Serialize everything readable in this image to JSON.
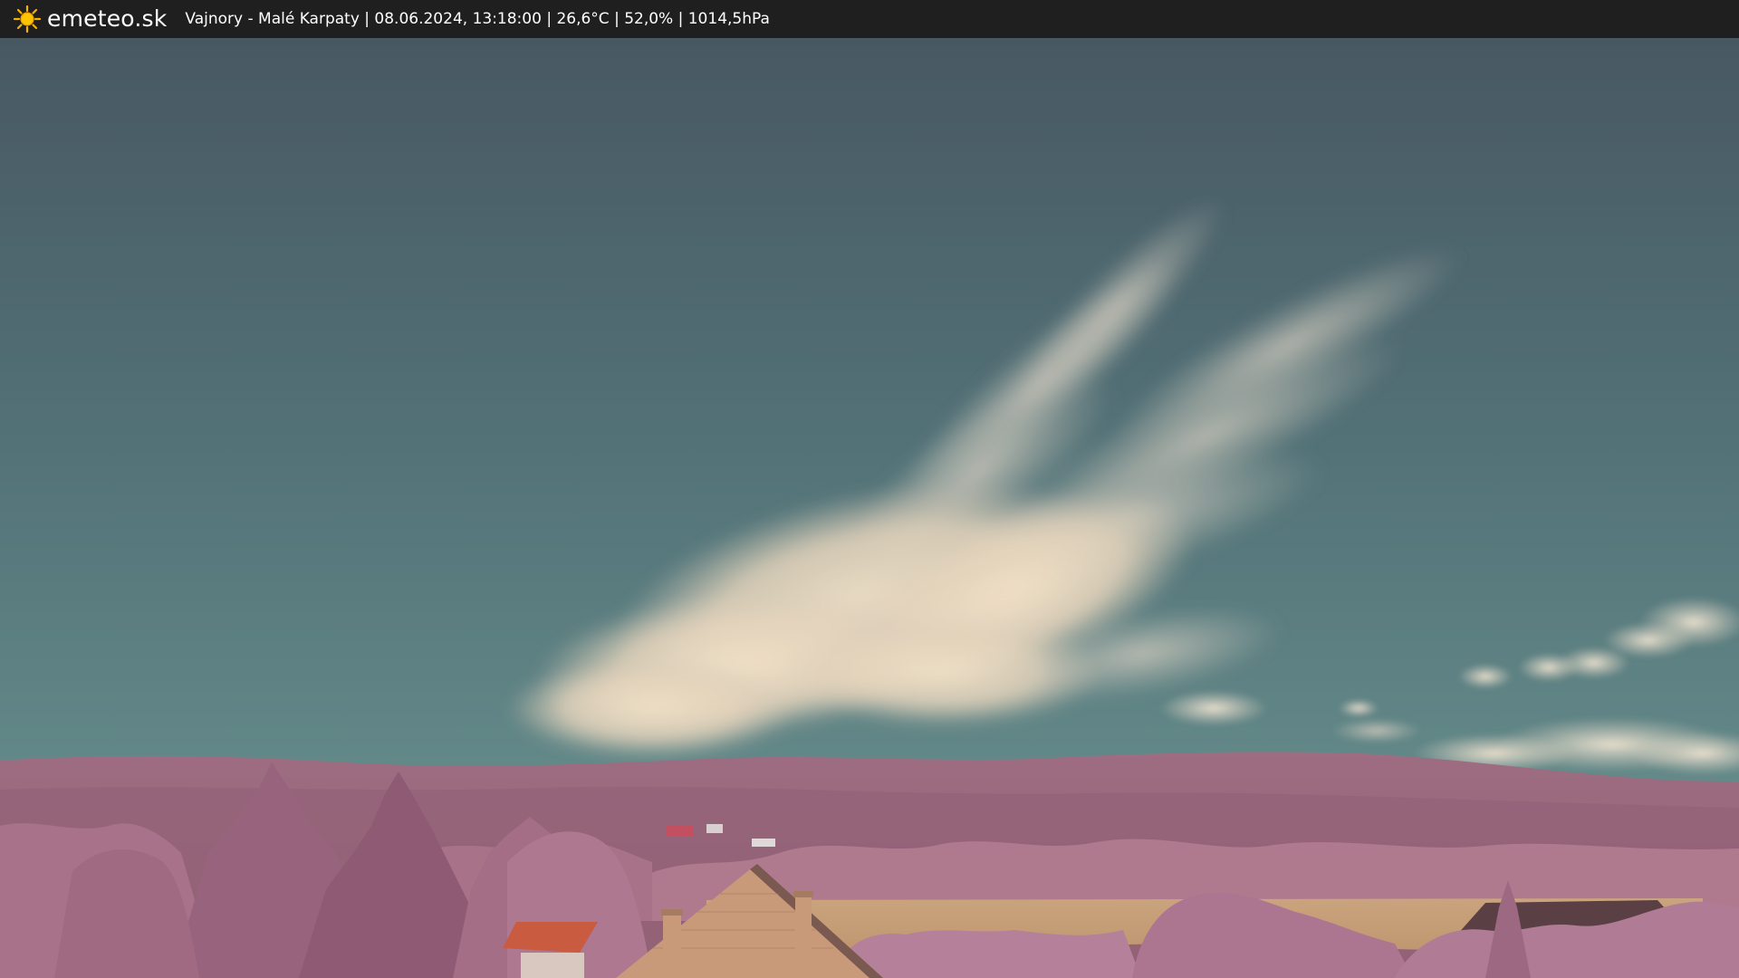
{
  "header": {
    "brand": "emeteo.sk",
    "logo_icon": "sun-icon",
    "caption": "Vajnory - Malé Karpaty | 08.06.2024, 13:18:00 | 26,6°C | 52,0% | 1014,5hPa"
  },
  "colors": {
    "bar_background": "#1f1f1f",
    "sky_top": "#4a5a64",
    "sky_bottom": "#5f8789",
    "cloud": "#e6d8c2",
    "hills": "#9c6a80",
    "foliage": "#b5798f",
    "field": "#c9a37c",
    "roof": "#c85b40"
  }
}
